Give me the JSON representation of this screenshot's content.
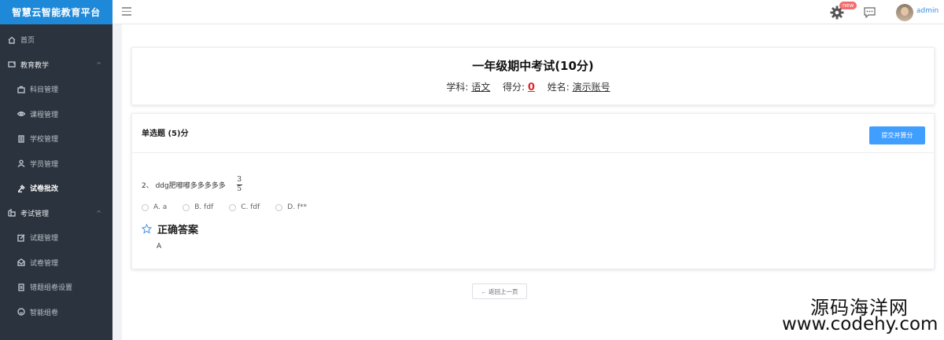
{
  "brand": "智慧云智能教育平台",
  "sidebar": {
    "items": [
      {
        "label": "首页",
        "icon": "home-icon"
      },
      {
        "label": "教育教学",
        "icon": "teaching-icon"
      },
      {
        "label": "科目管理",
        "icon": "briefcase-icon"
      },
      {
        "label": "课程管理",
        "icon": "eye-icon"
      },
      {
        "label": "学校管理",
        "icon": "school-icon"
      },
      {
        "label": "学员管理",
        "icon": "user-icon"
      },
      {
        "label": "试卷批改",
        "icon": "gavel-icon"
      },
      {
        "label": "考试管理",
        "icon": "exam-icon"
      },
      {
        "label": "试题管理",
        "icon": "edit-icon"
      },
      {
        "label": "试卷管理",
        "icon": "mail-icon"
      },
      {
        "label": "错题组卷设置",
        "icon": "doc-icon"
      },
      {
        "label": "智能组卷",
        "icon": "smile-icon"
      }
    ],
    "chevron": "^"
  },
  "topbar": {
    "badge": "new",
    "username": "admin"
  },
  "exam": {
    "title": "一年级期中考试(10分)",
    "subject_label": "学科:",
    "subject": "语文",
    "score_label": "得分:",
    "score": "0",
    "name_label": "姓名:",
    "name": "演示账号"
  },
  "section": {
    "title": "单选题 (5)分",
    "submit": "提交并算分"
  },
  "question": {
    "text": "2、 ddg肥嘟嘟多多多多多",
    "frac_num": "3",
    "frac_den": "5",
    "options": [
      "A. a",
      "B. fdf",
      "C. fdf",
      "D. f**"
    ]
  },
  "answer": {
    "title": "正确答案",
    "value": "A"
  },
  "back_button": "← 返回上一页",
  "watermark": {
    "cn": "源码海洋网",
    "en": "www.codehy.com"
  },
  "colors": {
    "sidebar_bg": "#2b333e",
    "brand_bg": "#1e88d9",
    "primary": "#409eff",
    "score_red": "#e3262c"
  }
}
